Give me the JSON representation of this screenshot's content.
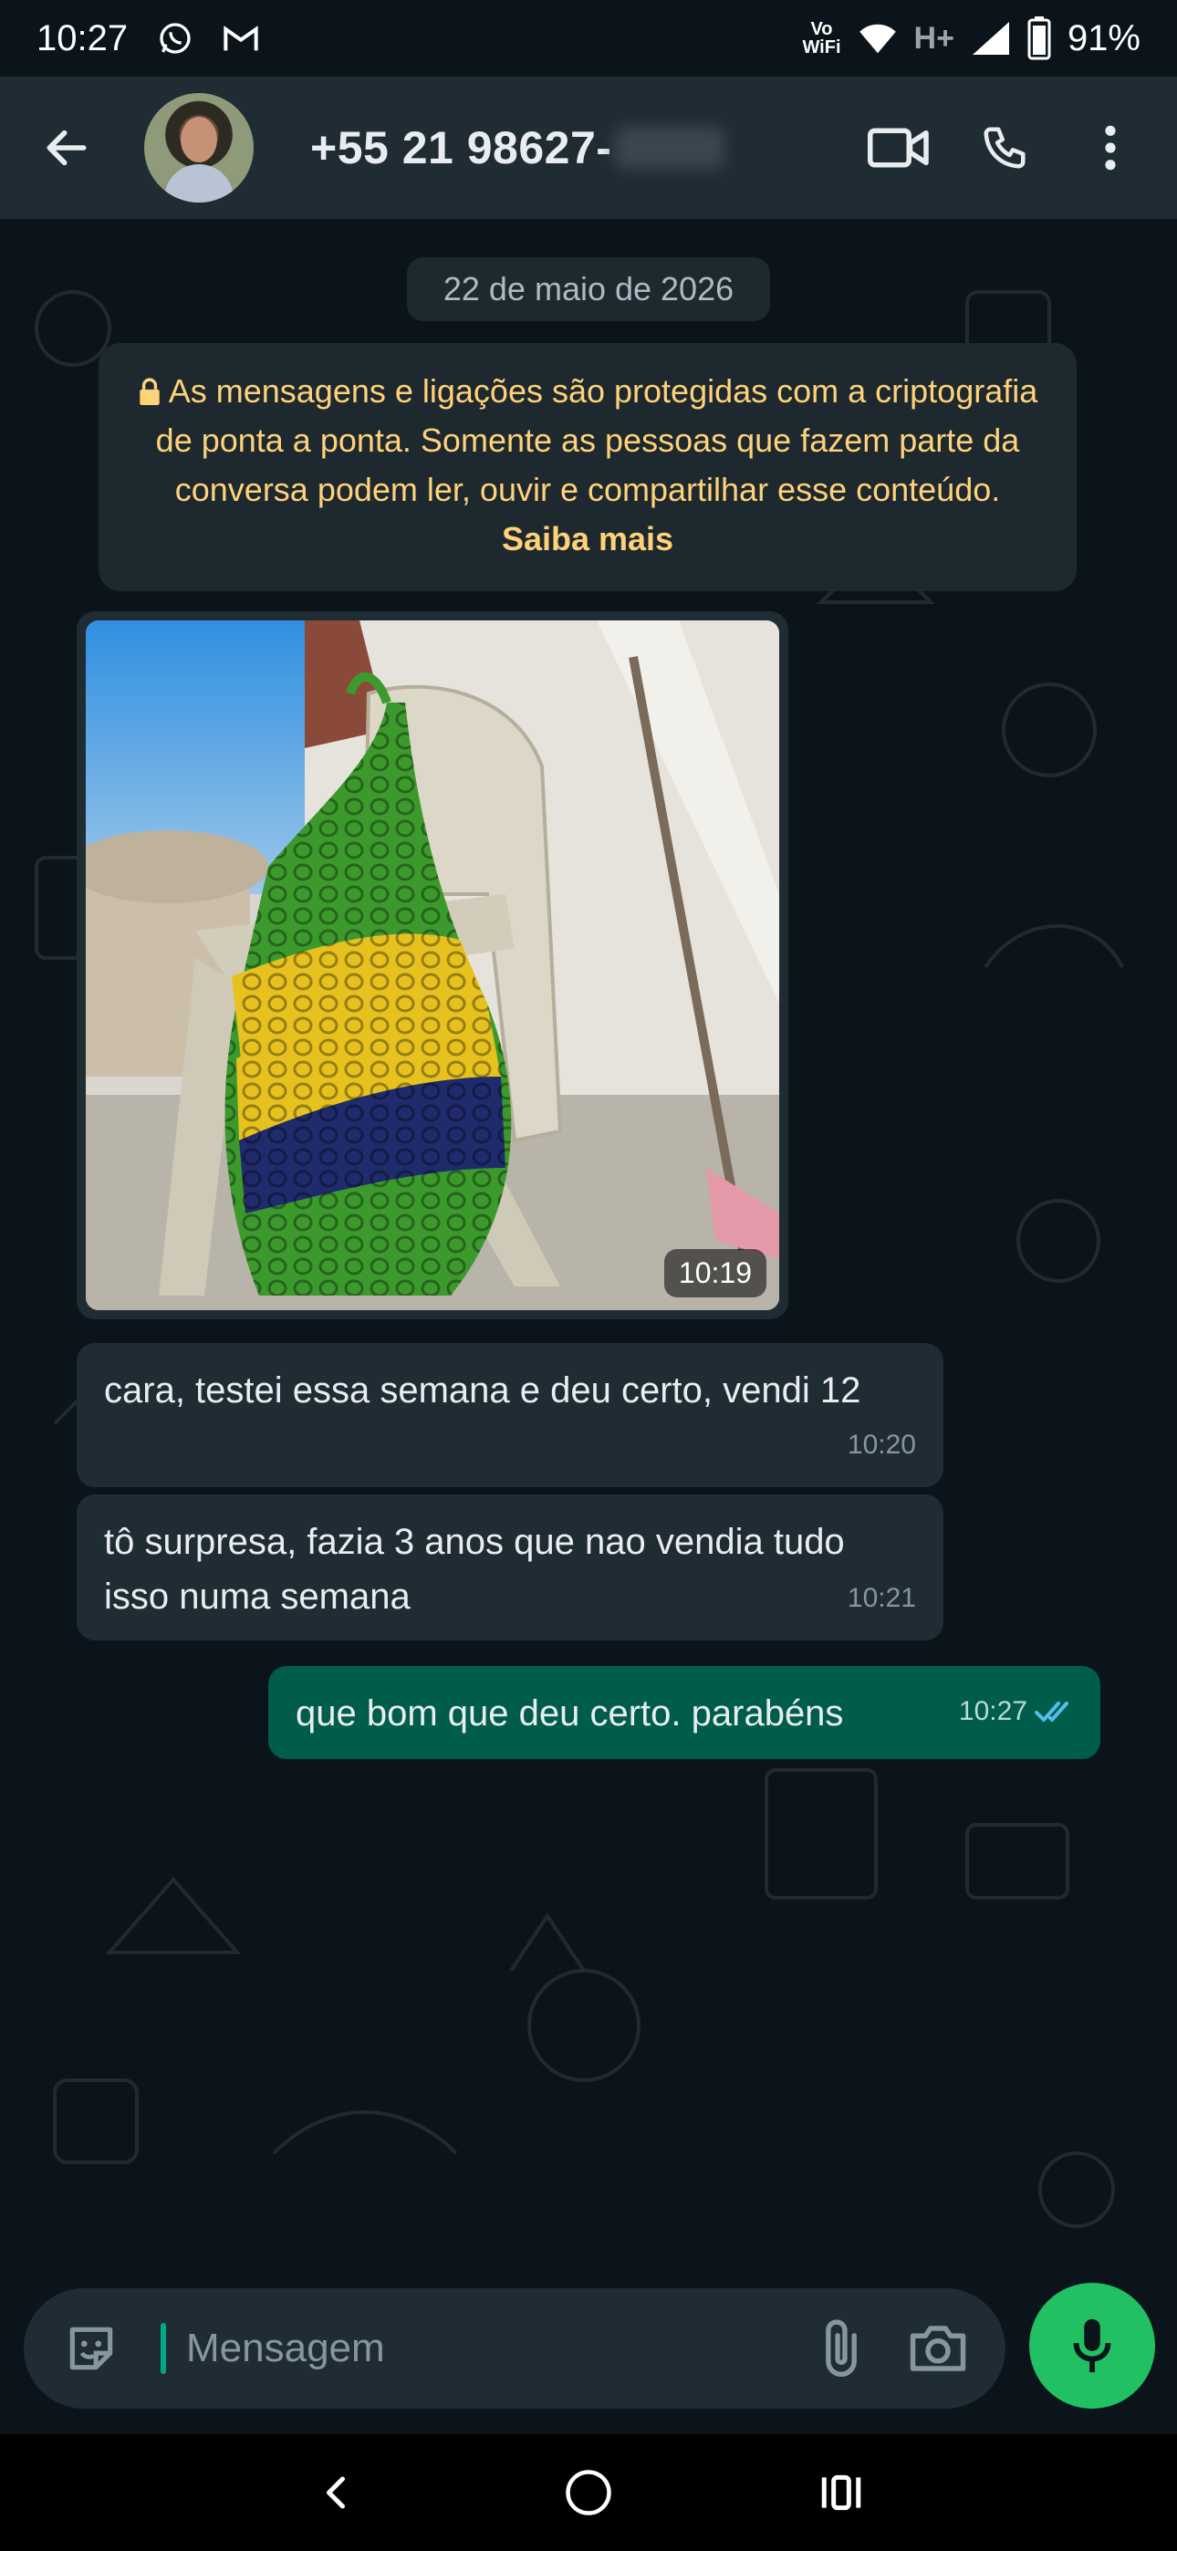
{
  "status_bar": {
    "time": "10:27",
    "left_icons": [
      "whatsapp-icon",
      "gmail-icon"
    ],
    "vowifi_top": "Vo",
    "vowifi_bottom": "WiFi",
    "network": "H+",
    "battery": "91%"
  },
  "header": {
    "contact_number": "+55 21 98627-",
    "actions": [
      "video-call-icon",
      "voice-call-icon",
      "more-options-icon"
    ]
  },
  "chat": {
    "date_chip": "22 de maio de 2026",
    "encryption": {
      "text": "As mensagens e ligações são protegidas com a criptografia de ponta a ponta. Somente as pessoas que fazem parte da conversa podem ler, ouvir e compartilhar esse conteúdo.",
      "link": "Saiba mais"
    },
    "photo_message": {
      "time": "10:19"
    },
    "messages": [
      {
        "direction": "in",
        "text": "cara, testei essa semana e deu certo, vendi 12",
        "time": "10:20"
      },
      {
        "direction": "in",
        "text": "tô surpresa, fazia 3 anos que nao vendia tudo isso numa semana",
        "time": "10:21"
      },
      {
        "direction": "out",
        "text": "que bom que deu certo. parabéns",
        "time": "10:27",
        "status": "read"
      }
    ]
  },
  "composer": {
    "placeholder": "Mensagem"
  },
  "colors": {
    "background": "#0b141a",
    "header": "#1f2c34",
    "incoming_bubble": "#1f2c34",
    "outgoing_bubble": "#005c4b",
    "accent": "#21c063",
    "encryption_text": "#ffd279",
    "read_ticks": "#53bdeb"
  }
}
